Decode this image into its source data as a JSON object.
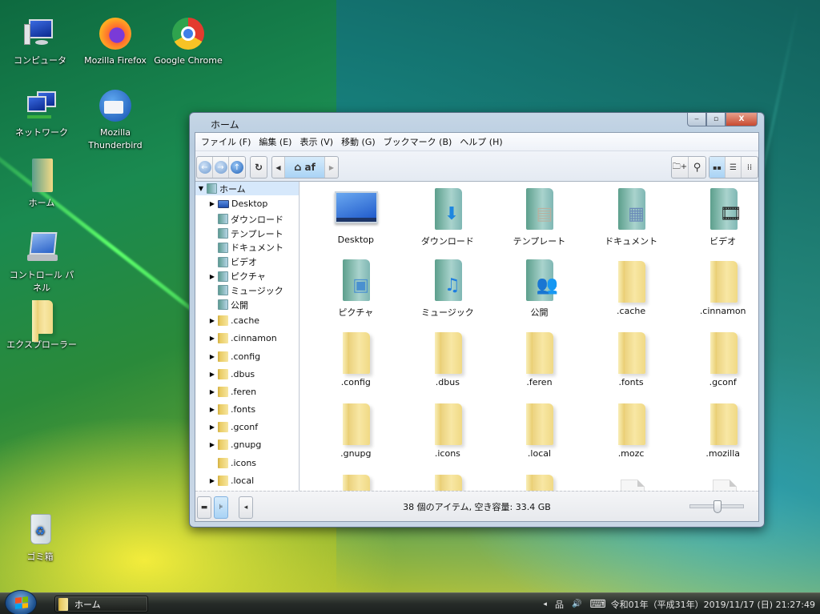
{
  "desktop": {
    "icons": [
      {
        "label": "コンピュータ",
        "icon": "computer-icon"
      },
      {
        "label": "Mozilla Firefox",
        "icon": "firefox-icon"
      },
      {
        "label": "Google Chrome",
        "icon": "chrome-icon"
      },
      {
        "label": "ネットワーク",
        "icon": "network-icon"
      },
      {
        "label": "Mozilla Thunderbird",
        "icon": "thunderbird-icon"
      },
      {
        "label": "ホーム",
        "icon": "home-folder-icon"
      },
      {
        "label": "コントロール パネル",
        "icon": "control-panel-icon"
      },
      {
        "label": "エクスプローラー",
        "icon": "explorer-folder-icon"
      },
      {
        "label": "ゴミ箱",
        "icon": "trash-icon"
      }
    ]
  },
  "window": {
    "title": "ホーム",
    "controls": {
      "minimize": "‒",
      "maximize": "▫",
      "close": "X"
    },
    "menu": [
      "ファイル (F)",
      "編集 (E)",
      "表示 (V)",
      "移動 (G)",
      "ブックマーク (B)",
      "ヘルプ (H)"
    ],
    "toolbar": {
      "back": "←",
      "forward": "→",
      "up": "↑",
      "reload": "↻",
      "path_left": "◀",
      "path_current": "af",
      "path_right": "▶",
      "home_glyph": "⌂",
      "new_folder": "🗀+",
      "search": "⚲",
      "view_icons": "▪▪",
      "view_list": "☰",
      "view_compact": "⁞⁞"
    },
    "sidebar": {
      "root": "ホーム",
      "items": [
        {
          "label": "Desktop",
          "type": "desk",
          "expander": true
        },
        {
          "label": "ダウンロード",
          "type": "sys",
          "expander": false
        },
        {
          "label": "テンプレート",
          "type": "sys",
          "expander": false
        },
        {
          "label": "ドキュメント",
          "type": "sys",
          "expander": false
        },
        {
          "label": "ビデオ",
          "type": "sys",
          "expander": false
        },
        {
          "label": "ピクチャ",
          "type": "sys",
          "expander": true
        },
        {
          "label": "ミュージック",
          "type": "sys",
          "expander": false
        },
        {
          "label": "公開",
          "type": "sys",
          "expander": false
        },
        {
          "label": ".cache",
          "type": "folder",
          "expander": true
        },
        {
          "label": ".cinnamon",
          "type": "folder",
          "expander": true
        },
        {
          "label": ".config",
          "type": "folder",
          "expander": true
        },
        {
          "label": ".dbus",
          "type": "folder",
          "expander": true
        },
        {
          "label": ".feren",
          "type": "folder",
          "expander": true
        },
        {
          "label": ".fonts",
          "type": "folder",
          "expander": true
        },
        {
          "label": ".gconf",
          "type": "folder",
          "expander": true
        },
        {
          "label": ".gnupg",
          "type": "folder",
          "expander": true
        },
        {
          "label": ".icons",
          "type": "folder",
          "expander": false
        },
        {
          "label": ".local",
          "type": "folder",
          "expander": true
        }
      ]
    },
    "files": [
      {
        "name": "Desktop",
        "kind": "desktop"
      },
      {
        "name": "ダウンロード",
        "kind": "sys",
        "overlay": "⬇",
        "color": "#1e86e0"
      },
      {
        "name": "テンプレート",
        "kind": "sys",
        "overlay": "▤",
        "color": "#b8b0a0"
      },
      {
        "name": "ドキュメント",
        "kind": "sys",
        "overlay": "▦",
        "color": "#6a8ab8"
      },
      {
        "name": "ビデオ",
        "kind": "sys",
        "overlay": "🎞",
        "color": "#222222"
      },
      {
        "name": "ピクチャ",
        "kind": "sys",
        "overlay": "▣",
        "color": "#4a90d0"
      },
      {
        "name": "ミュージック",
        "kind": "sys",
        "overlay": "♫",
        "color": "#1e7ee0"
      },
      {
        "name": "公開",
        "kind": "sys",
        "overlay": "👥",
        "color": "#7a5a3a"
      },
      {
        "name": ".cache",
        "kind": "folder"
      },
      {
        "name": ".cinnamon",
        "kind": "folder"
      },
      {
        "name": ".config",
        "kind": "folder"
      },
      {
        "name": ".dbus",
        "kind": "folder"
      },
      {
        "name": ".feren",
        "kind": "folder"
      },
      {
        "name": ".fonts",
        "kind": "folder"
      },
      {
        "name": ".gconf",
        "kind": "folder"
      },
      {
        "name": ".gnupg",
        "kind": "folder"
      },
      {
        "name": ".icons",
        "kind": "folder"
      },
      {
        "name": ".local",
        "kind": "folder"
      },
      {
        "name": ".mozc",
        "kind": "folder"
      },
      {
        "name": ".mozilla",
        "kind": "folder"
      },
      {
        "name": "",
        "kind": "folder"
      },
      {
        "name": "",
        "kind": "folder"
      },
      {
        "name": "",
        "kind": "folder"
      },
      {
        "name": "",
        "kind": "file"
      },
      {
        "name": "",
        "kind": "file"
      }
    ],
    "status": {
      "text": "38 個のアイテム, 空き容量: 33.4 GB",
      "zoom_level_fraction": 0.5,
      "places_btn": "▬",
      "tree_btn": "⊧",
      "toggle_pane_btn": "◂"
    }
  },
  "taskbar": {
    "tasks": [
      {
        "label": "ホーム"
      }
    ],
    "tray": {
      "arrow": "◂",
      "network": "品",
      "volume": "🔊",
      "keyboard": "⌨",
      "clock": "令和01年（平成31年）2019/11/17 (日) 21:27:49"
    }
  }
}
